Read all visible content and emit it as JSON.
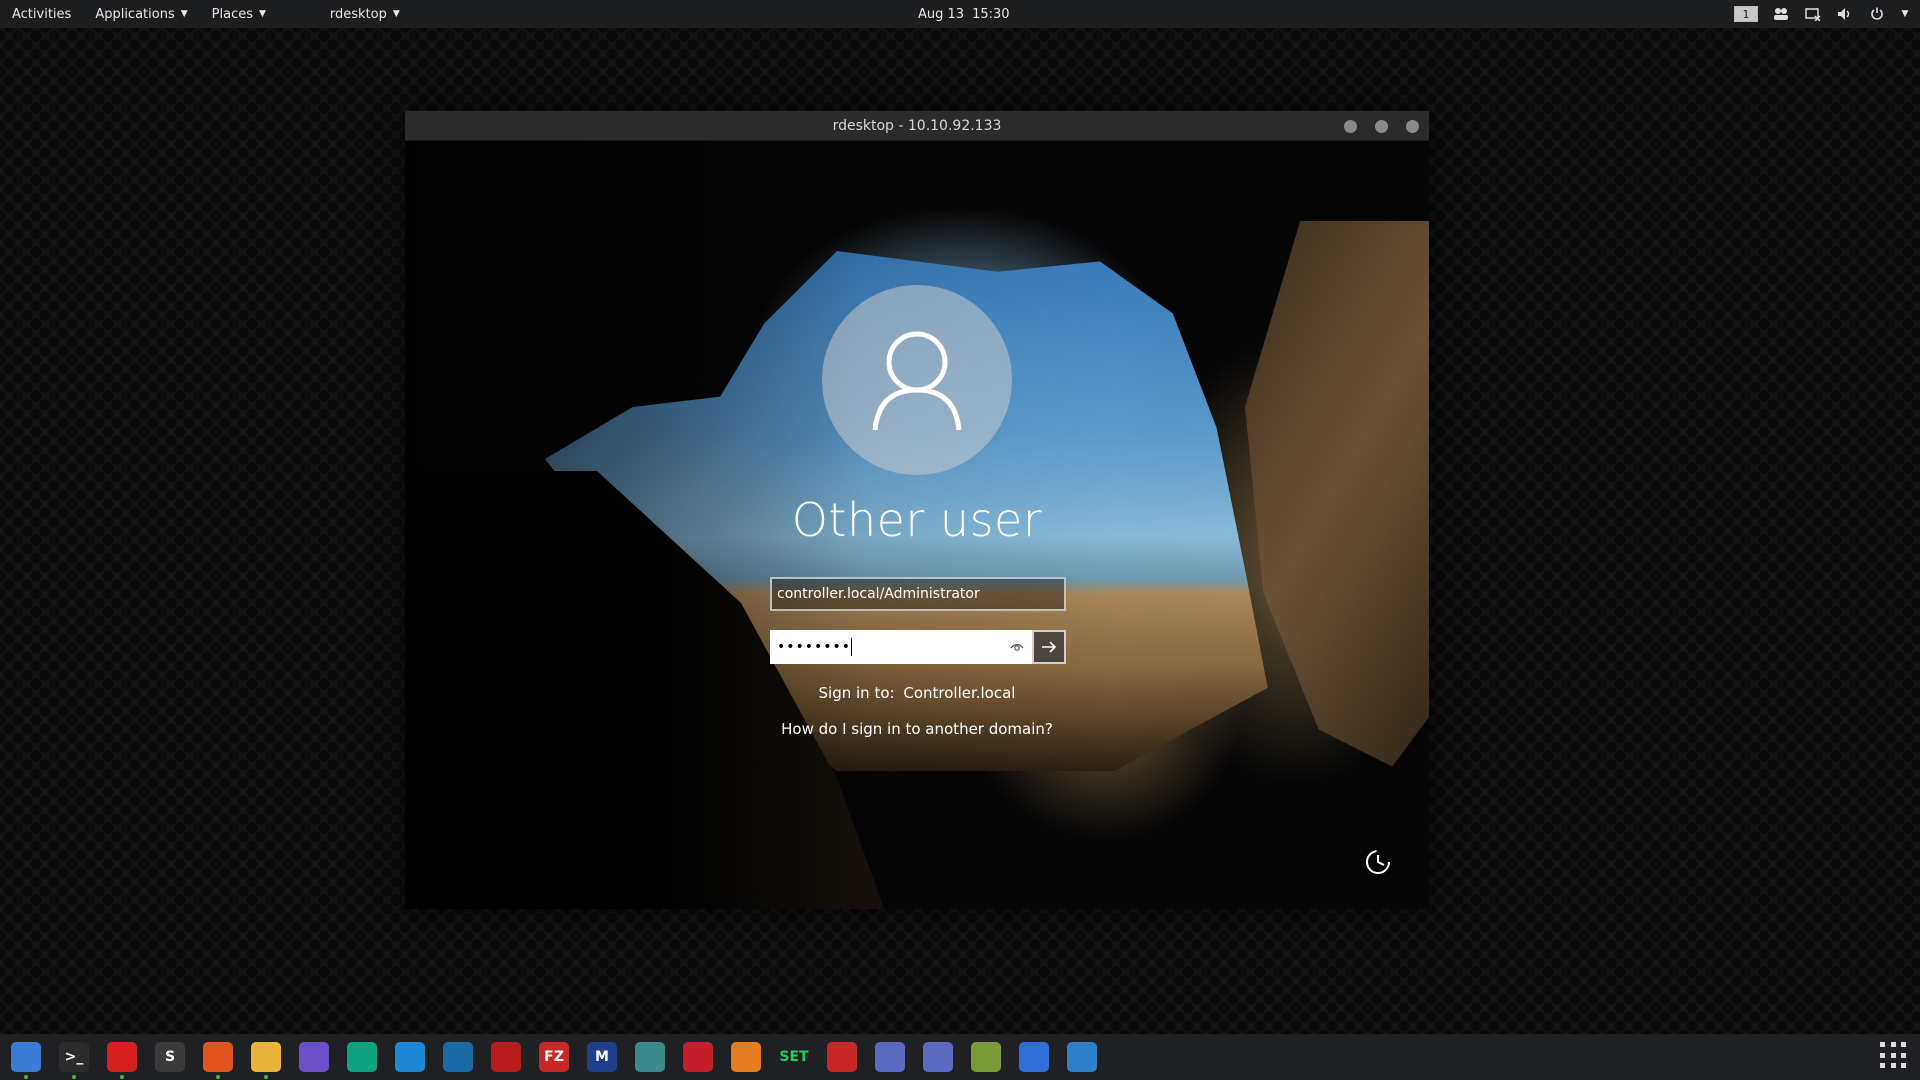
{
  "topbar": {
    "activities": "Activities",
    "applications": "Applications",
    "places": "Places",
    "app_menu": "rdesktop",
    "date": "Aug 13",
    "time": "15:30",
    "workspace": "1"
  },
  "window": {
    "title": "rdesktop - 10.10.92.133"
  },
  "login": {
    "user_title": "Other user",
    "username_value": "controller.local/Administrator",
    "password_mask": "••••••••",
    "signin_label": "Sign in to:",
    "signin_domain": "Controller.local",
    "help_link": "How do I sign in to another domain?"
  },
  "dock": {
    "apps": [
      {
        "name": "files",
        "label": "",
        "color": "#3a7bd5",
        "running": true
      },
      {
        "name": "terminal",
        "label": ">_",
        "color": "#2b2b2b",
        "running": true
      },
      {
        "name": "red-app",
        "label": "",
        "color": "#d62020",
        "running": true
      },
      {
        "name": "sublime",
        "label": "S",
        "color": "#3a3a3a",
        "running": false
      },
      {
        "name": "firefox",
        "label": "",
        "color": "#e2541f",
        "running": true
      },
      {
        "name": "chrome",
        "label": "",
        "color": "#e8b53a",
        "running": true
      },
      {
        "name": "screen-app",
        "label": "",
        "color": "#6b4fc8",
        "running": false
      },
      {
        "name": "openai",
        "label": "",
        "color": "#10a37f",
        "running": false
      },
      {
        "name": "eye-app",
        "label": "",
        "color": "#1e88d6",
        "running": false
      },
      {
        "name": "wireshark",
        "label": "",
        "color": "#1b6aa5",
        "running": false
      },
      {
        "name": "burp",
        "label": "",
        "color": "#b71c1c",
        "running": false
      },
      {
        "name": "filezilla",
        "label": "FZ",
        "color": "#c62828",
        "running": false
      },
      {
        "name": "metasploit",
        "label": "M",
        "color": "#1e3f8a",
        "running": false
      },
      {
        "name": "maltego",
        "label": "",
        "color": "#3b8a8a",
        "running": false
      },
      {
        "name": "red-arrow",
        "label": "",
        "color": "#c41f2b",
        "running": false
      },
      {
        "name": "set-bolt",
        "label": "",
        "color": "#e57c1f",
        "running": false
      },
      {
        "name": "set",
        "label": "SET",
        "color": "#1f2023",
        "running": false
      },
      {
        "name": "no-signal",
        "label": "",
        "color": "#c62828",
        "running": false
      },
      {
        "name": "x-tool",
        "label": "",
        "color": "#5a6bbf",
        "running": false
      },
      {
        "name": "recorder",
        "label": "",
        "color": "#5c6bc0",
        "running": false
      },
      {
        "name": "folder-app",
        "label": "",
        "color": "#7a9a3a",
        "running": false
      },
      {
        "name": "settings",
        "label": "",
        "color": "#2f6ed6",
        "running": false
      },
      {
        "name": "molecule",
        "label": "",
        "color": "#2f80c8",
        "running": false
      }
    ]
  }
}
